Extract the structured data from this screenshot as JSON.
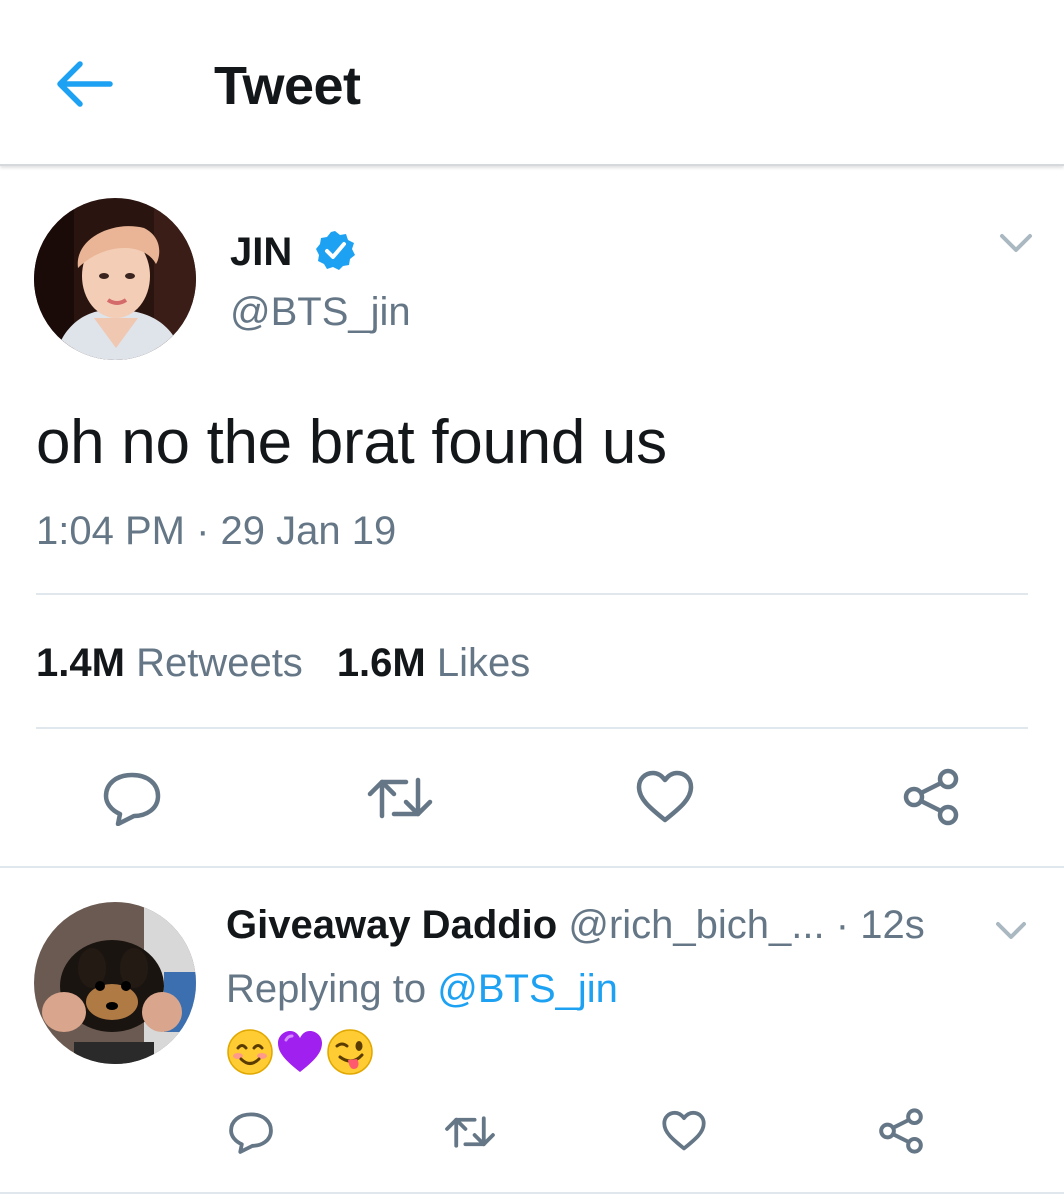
{
  "header": {
    "title": "Tweet",
    "back_icon": "arrow-left-icon",
    "accent": "#1da1f2"
  },
  "tweet": {
    "author_name": "JIN",
    "verified_icon": "verified-badge-icon",
    "handle": "@BTS_jin",
    "text": "oh no the brat found us",
    "timestamp": "1:04 PM · 29 Jan 19",
    "retweets_count": "1.4M",
    "retweets_label": "Retweets",
    "likes_count": "1.6M",
    "likes_label": "Likes",
    "actions": [
      "reply-icon",
      "retweet-icon",
      "like-icon",
      "share-icon"
    ]
  },
  "reply": {
    "author_name": "Giveaway Daddio",
    "handle": "@rich_bich_...",
    "time": "· 12s",
    "replying_prefix": "Replying to",
    "replying_handle": "@BTS_jin",
    "emojis": [
      "smiling-face-icon",
      "purple-heart-icon",
      "winking-tongue-face-icon"
    ],
    "actions": [
      "reply-icon",
      "retweet-icon",
      "like-icon",
      "share-icon"
    ]
  },
  "colors": {
    "text_primary": "#14171a",
    "text_secondary": "#657786",
    "icon_gray": "#657786",
    "divider": "#e1e8ed",
    "verified_blue": "#1da1f2"
  }
}
